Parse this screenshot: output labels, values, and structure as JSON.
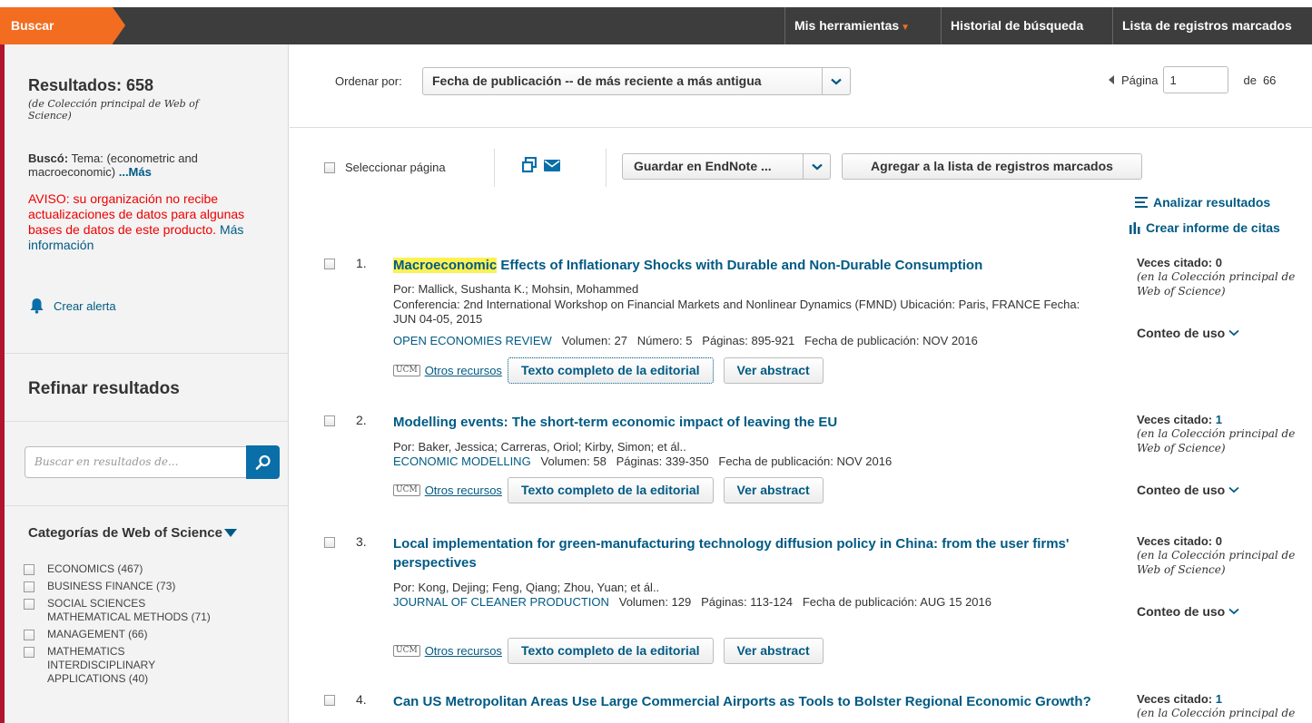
{
  "topbar": {
    "search_tab": "Buscar",
    "tools": "Mis herramientas",
    "history": "Historial de búsqueda",
    "marked_list": "Lista de registros marcados"
  },
  "sidebar": {
    "results_count": "Resultados: 658",
    "results_source": "(de Colección principal de Web of Science)",
    "searched_label": "Buscó:",
    "searched_query": "Tema: (econometric and macroeconomic)",
    "more_link": "...Más",
    "notice": "AVISO: su organización no recibe actualizaciones de datos para algunas bases de datos de este producto.",
    "notice_link": "Más información",
    "create_alert": "Crear alerta",
    "refine_title": "Refinar resultados",
    "refine_search_placeholder": "Buscar en resultados de...",
    "categories_title": "Categorías de Web of Science",
    "categories": [
      {
        "label": "ECONOMICS (467)"
      },
      {
        "label": "BUSINESS FINANCE (73)"
      },
      {
        "label": "SOCIAL SCIENCES MATHEMATICAL METHODS (71)"
      },
      {
        "label": "MANAGEMENT (66)"
      },
      {
        "label": "MATHEMATICS INTERDISCIPLINARY APPLICATIONS (40)"
      }
    ]
  },
  "sort": {
    "label": "Ordenar por:",
    "selected": "Fecha de publicación -- de más reciente a más antigua"
  },
  "pager": {
    "label": "Página",
    "current": "1",
    "of_label": "de",
    "total": "66"
  },
  "toolbar": {
    "select_page": "Seleccionar página",
    "endnote": "Guardar en EndNote ...",
    "add_marked": "Agregar a la lista de registros marcados",
    "analyze": "Analizar resultados",
    "citation_report": "Crear informe de citas"
  },
  "record_labels": {
    "other_resources": "Otros recursos",
    "full_text": "Texto completo de la editorial",
    "abstract": "Ver abstract",
    "cited_prefix": "Veces citado:",
    "cited_note": "(en la Colección principal de Web of Science)",
    "usage": "Conteo de uso",
    "ucm": "UCM"
  },
  "records": [
    {
      "num": "1.",
      "title_highlight": "Macroeconomic",
      "title_rest": " Effects of Inflationary Shocks with Durable and Non-Durable Consumption",
      "authors": "Por: Mallick, Sushanta K.; Mohsin, Mohammed",
      "conference": "Conferencia: 2nd International Workshop on Financial Markets and Nonlinear Dynamics (FMND) Ubicación: Paris, FRANCE Fecha: JUN 04-05, 2015",
      "journal": "OPEN ECONOMIES REVIEW",
      "details": "Volumen: 27   Número: 5   Páginas: 895-921   Fecha de publicación: NOV 2016",
      "cited": "0"
    },
    {
      "num": "2.",
      "title": "Modelling events: The short-term economic impact of leaving the EU",
      "authors": "Por: Baker, Jessica; Carreras, Oriol; Kirby, Simon; et ál..",
      "journal": "ECONOMIC MODELLING",
      "details": "Volumen: 58   Páginas: 339-350   Fecha de publicación: NOV 2016",
      "cited": "1"
    },
    {
      "num": "3.",
      "title": "Local implementation for green-manufacturing technology diffusion policy in China: from the user firms' perspectives",
      "authors": "Por: Kong, Dejing; Feng, Qiang; Zhou, Yuan; et ál..",
      "journal": "JOURNAL OF CLEANER PRODUCTION",
      "details": "Volumen: 129   Páginas: 113-124   Fecha de publicación: AUG 15 2016",
      "cited": "0"
    },
    {
      "num": "4.",
      "title": "Can US Metropolitan Areas Use Large Commercial Airports as Tools to Bolster Regional Economic Growth?",
      "cited": "1"
    }
  ]
}
